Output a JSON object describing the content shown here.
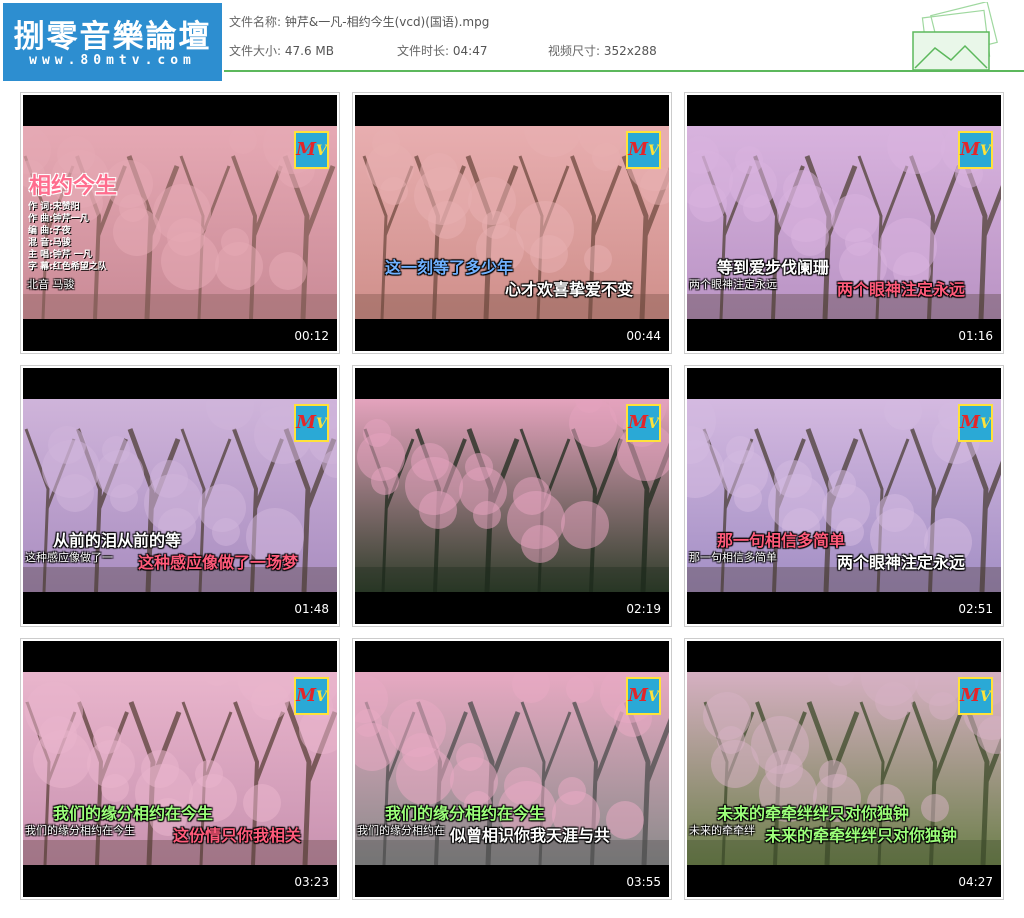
{
  "logo": {
    "title": "捌零音樂論壇",
    "url": "www.80mtv.com"
  },
  "file": {
    "name_label": "文件名称:",
    "name_value": "钟芹&一凡-相约今生(vcd)(国语).mpg",
    "size_label": "文件大小:",
    "size_value": "47.6 MB",
    "duration_label": "文件时长:",
    "duration_value": "04:47",
    "dimension_label": "视频尺寸:",
    "dimension_value": "352x288"
  },
  "colors": {
    "accent": "#5cb85c",
    "logo_bg": "#2d8ed0"
  },
  "thumbnails": [
    {
      "timestamp": "00:12",
      "song_title": "相约今生",
      "credits": [
        "作 词:宋赞阳",
        "作 曲:钟芹一凡",
        "编 曲:子夜",
        "混 音:马骏",
        "主 唱:钟芹 一凡",
        "字 幕:红色希望之队"
      ],
      "subs": [
        {
          "text": "北音 马骏",
          "style": "small"
        }
      ]
    },
    {
      "timestamp": "00:44",
      "subs": [
        {
          "text": "这一刻等了多少年",
          "style": "blue"
        },
        {
          "text": "心才欢喜挚爱不变",
          "style": "white"
        }
      ]
    },
    {
      "timestamp": "01:16",
      "subs": [
        {
          "text": "等到爱步伐阑珊",
          "style": "white"
        },
        {
          "text": "两个眼神注定永远",
          "style": "small"
        },
        {
          "text": "两个眼神注定永远",
          "style": "pink"
        }
      ]
    },
    {
      "timestamp": "01:48",
      "subs": [
        {
          "text": "从前的泪从前的等",
          "style": "white"
        },
        {
          "text": "这种感应像做了一",
          "style": "small"
        },
        {
          "text": "这种感应像做了一场梦",
          "style": "pink"
        }
      ]
    },
    {
      "timestamp": "02:19",
      "subs": []
    },
    {
      "timestamp": "02:51",
      "subs": [
        {
          "text": "那一句相信多简单",
          "style": "pink"
        },
        {
          "text": "那一句相信多简单",
          "style": "small"
        },
        {
          "text": "两个眼神注定永远",
          "style": "white"
        }
      ]
    },
    {
      "timestamp": "03:23",
      "subs": [
        {
          "text": "我们的缘分相约在今生",
          "style": "green"
        },
        {
          "text": "我们的缘分相约在今生",
          "style": "small"
        },
        {
          "text": "这份情只你我相关",
          "style": "pink"
        }
      ]
    },
    {
      "timestamp": "03:55",
      "subs": [
        {
          "text": "我们的缘分相约在今生",
          "style": "green"
        },
        {
          "text": "我们的缘分相约在",
          "style": "small"
        },
        {
          "text": "似曾相识你我天涯与共",
          "style": "white"
        }
      ]
    },
    {
      "timestamp": "04:27",
      "subs": [
        {
          "text": "未来的牵牵绊绊只对你独钟",
          "style": "green"
        },
        {
          "text": "未来的牵牵绊",
          "style": "small"
        },
        {
          "text": "未来的牵牵绊绊只对你独钟",
          "style": "green"
        }
      ]
    }
  ]
}
